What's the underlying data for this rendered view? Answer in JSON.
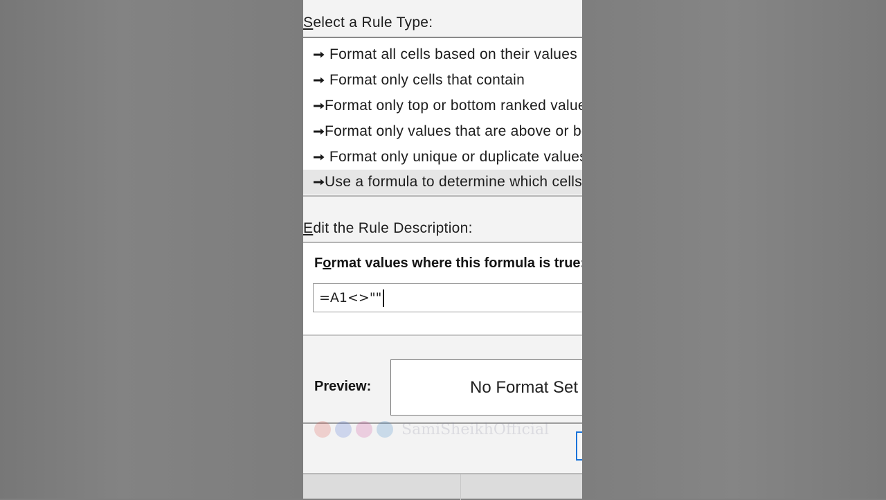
{
  "dialog": {
    "select_rule_type_label": {
      "accel": "S",
      "rest": "elect a Rule Type:"
    },
    "rule_types": [
      {
        "label": "Format all cells based on their values",
        "selected": false
      },
      {
        "label": "Format only cells that contain",
        "selected": false
      },
      {
        "label": "Format only top or bottom ranked values",
        "selected": false
      },
      {
        "label": "Format only values that are above or below average",
        "selected": false
      },
      {
        "label": "Format only unique or duplicate values",
        "selected": false
      },
      {
        "label": "Use a formula to determine which cells to format",
        "selected": true
      }
    ],
    "edit_rule_description_label": {
      "accel": "E",
      "rest": "dit the Rule Description:"
    },
    "formula_caption": {
      "pre": "F",
      "accel": "o",
      "rest": "rmat values where this formula is true:"
    },
    "formula_value": "=A1<>\"\"",
    "preview_label": "Preview:",
    "preview_text": "No Format Set",
    "watermark_text": "SamiSheikhOfficial",
    "colors": {
      "selected_row": "#e6e6e6",
      "focus_border": "#1a73d9",
      "dialog_bg": "#f3f3f3"
    }
  }
}
